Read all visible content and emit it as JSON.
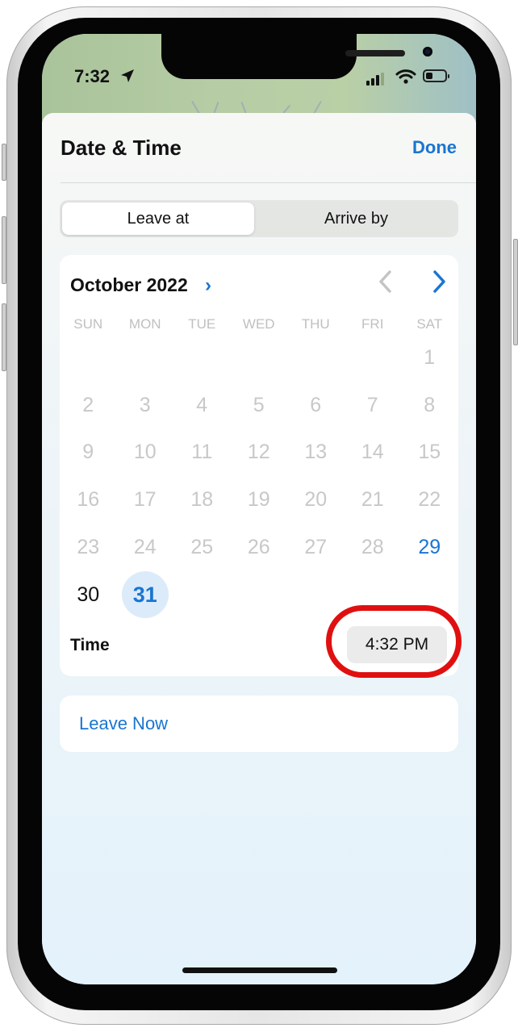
{
  "status_bar": {
    "time": "7:32",
    "icons": [
      "location-arrow-icon",
      "cellular-signal-icon",
      "wifi-icon",
      "battery-icon"
    ]
  },
  "sheet": {
    "title": "Date & Time",
    "done_label": "Done"
  },
  "mode_toggle": {
    "options": [
      "Leave at",
      "Arrive by"
    ],
    "selected": "Leave at"
  },
  "calendar": {
    "month_label": "October 2022",
    "month_chevron": "›",
    "weekdays": [
      "SUN",
      "MON",
      "TUE",
      "WED",
      "THU",
      "FRI",
      "SAT"
    ],
    "weeks": [
      [
        "",
        "",
        "",
        "",
        "",
        "",
        "1"
      ],
      [
        "2",
        "3",
        "4",
        "5",
        "6",
        "7",
        "8"
      ],
      [
        "9",
        "10",
        "11",
        "12",
        "13",
        "14",
        "15"
      ],
      [
        "16",
        "17",
        "18",
        "19",
        "20",
        "21",
        "22"
      ],
      [
        "23",
        "24",
        "25",
        "26",
        "27",
        "28",
        "29"
      ],
      [
        "30",
        "31",
        "",
        "",
        "",
        "",
        ""
      ]
    ],
    "available_days": [
      "29"
    ],
    "today": "30",
    "selected_day": "31"
  },
  "time": {
    "label": "Time",
    "value": "4:32 PM"
  },
  "leave_now_label": "Leave Now",
  "colors": {
    "accent": "#1a75d1",
    "highlight_ring": "#e01010",
    "selected_day_bg": "#dcebfa"
  }
}
